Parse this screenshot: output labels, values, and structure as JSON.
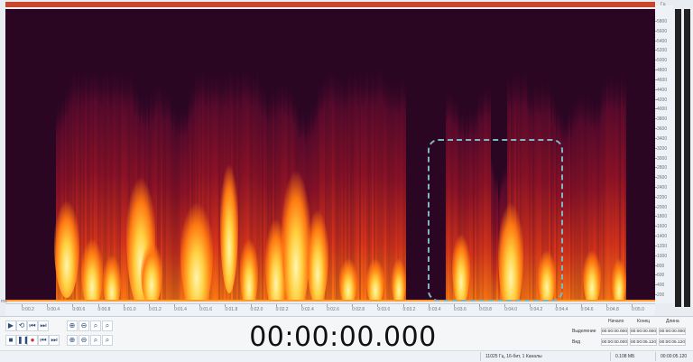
{
  "frequency_axis": {
    "unit": "Гц",
    "labels": [
      "5800",
      "5600",
      "5400",
      "5200",
      "5000",
      "4800",
      "4600",
      "4400",
      "4200",
      "4000",
      "3800",
      "3600",
      "3400",
      "3200",
      "3000",
      "2800",
      "2600",
      "2400",
      "2200",
      "2000",
      "1800",
      "1600",
      "1400",
      "1200",
      "1000",
      "800",
      "600",
      "400",
      "200"
    ]
  },
  "time_ruler": {
    "unit": "ms",
    "labels": [
      "0:00.2",
      "0:00.4",
      "0:00.6",
      "0:00.8",
      "0:01.0",
      "0:01.2",
      "0:01.4",
      "0:01.6",
      "0:01.8",
      "0:02.0",
      "0:02.2",
      "0:02.4",
      "0:02.6",
      "0:02.8",
      "0:03.0",
      "0:03.2",
      "0:03.4",
      "0:03.6",
      "0:03.8",
      "0:04.0",
      "0:04.2",
      "0:04.4",
      "0:04.6",
      "0:04.8",
      "0:05.0"
    ]
  },
  "transport": {
    "buttons": [
      {
        "name": "play-icon",
        "glyph": "▶"
      },
      {
        "name": "loop-icon",
        "glyph": "⟲"
      },
      {
        "name": "skip-start-icon",
        "glyph": "⏮"
      },
      {
        "name": "skip-end-icon",
        "glyph": "⏭"
      },
      {
        "name": "stop-icon",
        "glyph": "■"
      },
      {
        "name": "pause-icon",
        "glyph": "❚❚"
      },
      {
        "name": "record-icon",
        "glyph": "●"
      },
      {
        "name": "prev-icon",
        "glyph": "⏮"
      },
      {
        "name": "next-icon",
        "glyph": "⏭"
      }
    ]
  },
  "zoom": {
    "buttons": [
      {
        "name": "zoom-in-icon",
        "glyph": "⊕"
      },
      {
        "name": "zoom-out-icon",
        "glyph": "⊖"
      },
      {
        "name": "zoom-selection-icon",
        "glyph": "⌕"
      },
      {
        "name": "zoom-full-icon",
        "glyph": "⌕"
      },
      {
        "name": "zoom-in-vertical-icon",
        "glyph": "⊕"
      },
      {
        "name": "zoom-out-vertical-icon",
        "glyph": "⊖"
      },
      {
        "name": "zoom-fit-icon",
        "glyph": "⌕"
      },
      {
        "name": "zoom-reset-icon",
        "glyph": "⌕"
      }
    ]
  },
  "timer": "00:00:00.000",
  "selection_table": {
    "headers": [
      "Начало",
      "Конец",
      "Длина"
    ],
    "rows": [
      {
        "label": "Выделение",
        "values": [
          "00:00:00.000",
          "00:00:00.000",
          "00:00:00.000"
        ]
      },
      {
        "label": "Вид",
        "values": [
          "00:00:00.000",
          "00:00:05.120",
          "00:00:05.120"
        ]
      }
    ]
  },
  "status": {
    "format": "11025 Гц, 16-бит, 1 Каналы",
    "size": "0.108 МБ",
    "duration": "00:00:05.120"
  },
  "colors": {
    "spectrogram_bg": "#2a0622",
    "selection_border": "#7fb6c2",
    "accent_red": "#c8462b"
  }
}
